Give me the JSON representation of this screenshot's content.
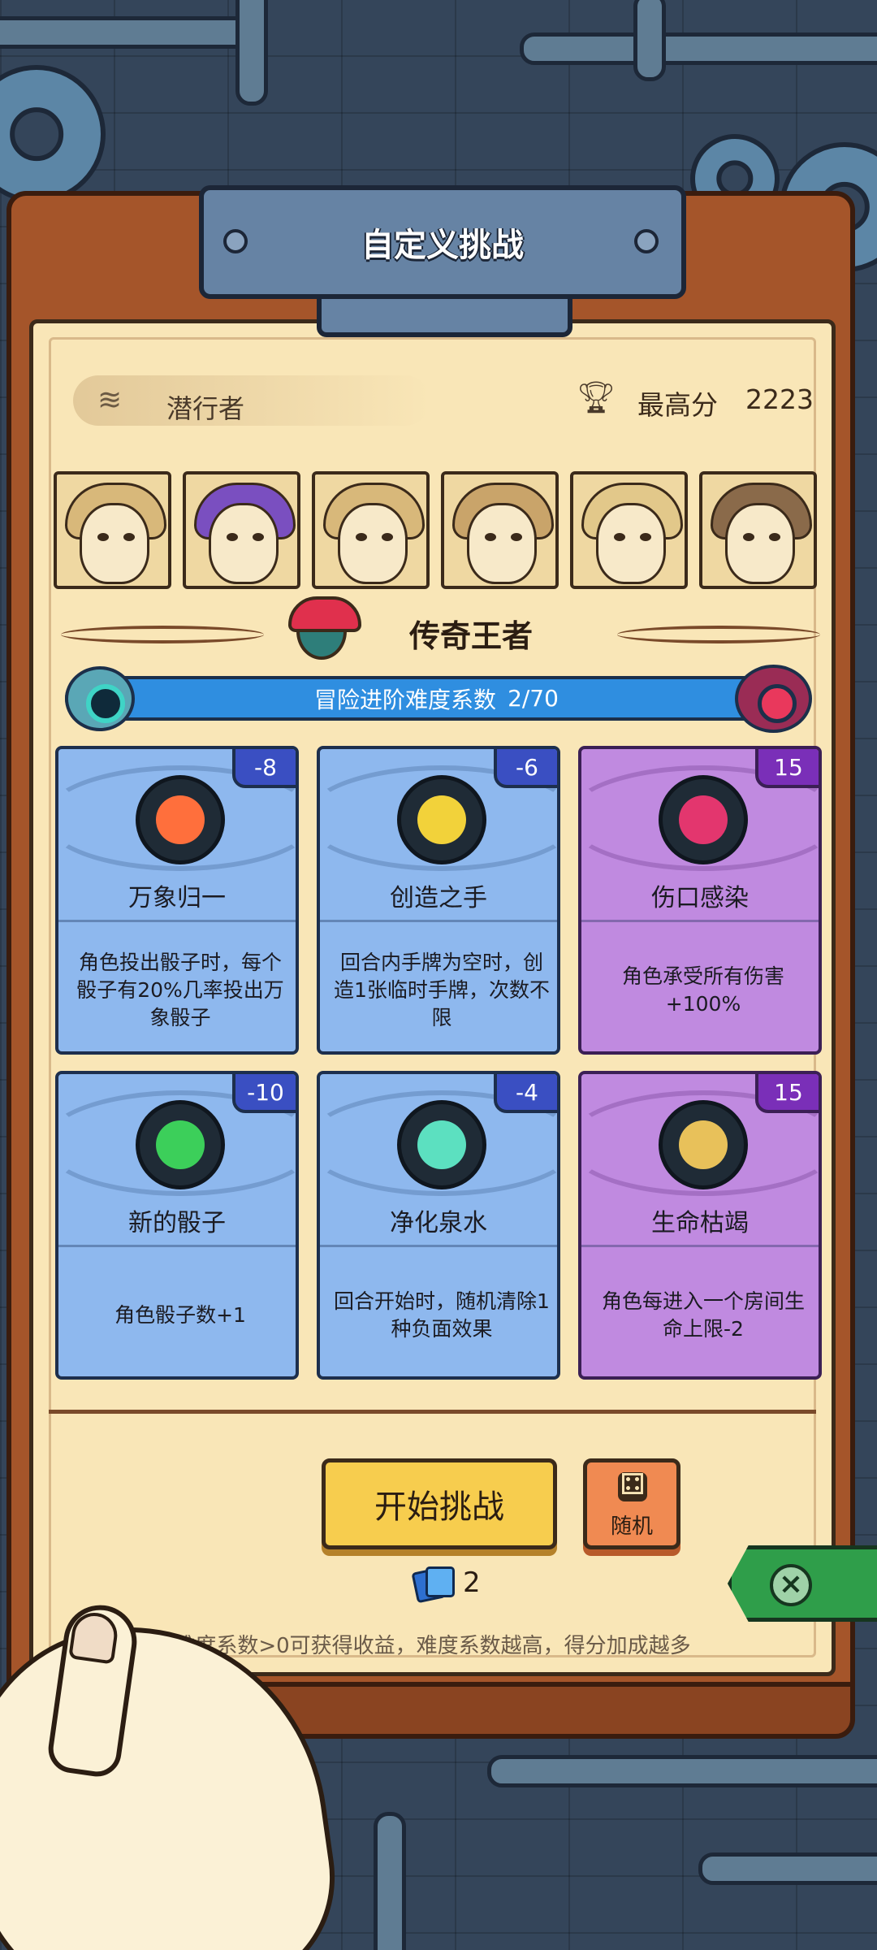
{
  "header": {
    "title": "自定义挑战"
  },
  "profile": {
    "class_icon": "claw-marks-icon",
    "class_name": "潜行者",
    "best_score_icon": "trophy-icon",
    "best_score_label": "最高分",
    "best_score_value": "2223"
  },
  "portraits": [
    {
      "name": "portrait-1",
      "hair": "#d8b87a"
    },
    {
      "name": "portrait-2",
      "hair": "#7a4fc0"
    },
    {
      "name": "portrait-3",
      "hair": "#d8b87a"
    },
    {
      "name": "portrait-4",
      "hair": "#c9a46a"
    },
    {
      "name": "portrait-5",
      "hair": "#e2c88a"
    },
    {
      "name": "portrait-6",
      "hair": "#8a6a4a"
    }
  ],
  "rank": {
    "badge_icon": "jester-crown-icon",
    "title": "传奇王者"
  },
  "difficulty": {
    "label": "冒险进阶难度系数",
    "value": "2/70",
    "current": 2,
    "max": 70
  },
  "cards": [
    {
      "name": "万象归一",
      "cost": "-8",
      "desc": "角色投出骰子时，每个骰子有20%几率投出万象骰子",
      "color": "blue",
      "emblem": "#ff6f3c",
      "icon": "spiral-icon"
    },
    {
      "name": "创造之手",
      "cost": "-6",
      "desc": "回合内手牌为空时，创造1张临时手牌，次数不限",
      "color": "blue",
      "emblem": "#f2d23a",
      "icon": "golden-hand-icon"
    },
    {
      "name": "伤口感染",
      "cost": "15",
      "desc": "角色承受所有伤害+100%",
      "color": "purple",
      "emblem": "#e3366e",
      "icon": "infected-hand-icon"
    },
    {
      "name": "新的骰子",
      "cost": "-10",
      "desc": "角色骰子数+1",
      "color": "blue",
      "emblem": "#3ccf5a",
      "icon": "glowing-dice-icon"
    },
    {
      "name": "净化泉水",
      "cost": "-4",
      "desc": "回合开始时，随机清除1种负面效果",
      "color": "blue",
      "emblem": "#5ce0c0",
      "icon": "spring-water-icon"
    },
    {
      "name": "生命枯竭",
      "cost": "15",
      "desc": "角色每进入一个房间生命上限-2",
      "color": "purple",
      "emblem": "#e8c15a",
      "icon": "melting-candle-icon"
    }
  ],
  "actions": {
    "start_label": "开始挑战",
    "random_label": "随机",
    "random_icon": "dice-icon",
    "ticket_icon": "card-ticket-icon",
    "ticket_count": "2",
    "close_icon": "close-icon"
  },
  "hint": "难度系数>0可获得收益，难度系数越高，得分加成越多"
}
